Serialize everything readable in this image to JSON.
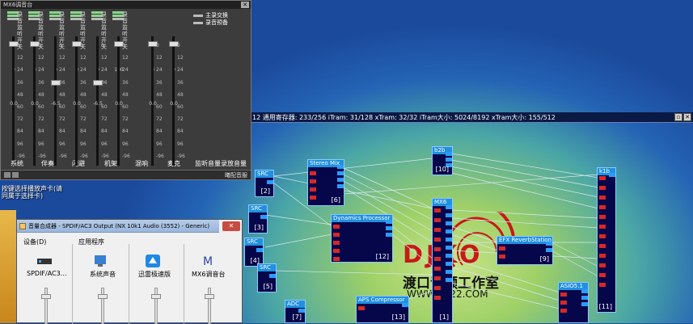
{
  "mixer": {
    "title": "MX6调音台",
    "switch_labels": [
      "主录交换",
      "录音预备"
    ],
    "channels": [
      {
        "name": "系统",
        "toggles": [
          "录",
          "监",
          "开"
        ],
        "toggles2": [
          "音",
          "听",
          "关"
        ],
        "value": "0.0",
        "level": 0.0
      },
      {
        "name": "伴奏",
        "toggles": [
          "录",
          "监",
          "开"
        ],
        "toggles2": [
          "音",
          "听",
          "关"
        ],
        "value": "0.0",
        "level": 0.0
      },
      {
        "name": "闪避",
        "toggles": [
          "录",
          "监",
          "开"
        ],
        "toggles2": [
          "音",
          "听",
          "关"
        ],
        "value": "-6.5",
        "level": 0.08
      },
      {
        "name": "机架",
        "toggles": [
          "录",
          "监",
          "开"
        ],
        "toggles2": [
          "音",
          "听",
          "关"
        ],
        "value": "0.0",
        "level": 0.0
      },
      {
        "name": "混响",
        "toggles": [
          "录",
          "监",
          "开"
        ],
        "toggles2": [
          "音",
          "听",
          "关"
        ],
        "value": "-6.5",
        "level": 0.08
      },
      {
        "name": "麦克",
        "toggles": [
          "录",
          "监",
          "开"
        ],
        "toggles2": [
          "音",
          "听",
          "关"
        ],
        "value": "0.0",
        "level": 0.0
      },
      {
        "name": "监听音量",
        "toggles": [],
        "toggles2": [],
        "value": "0.0",
        "level": 0.0
      },
      {
        "name": "录放音量",
        "toggles": [],
        "toggles2": [],
        "value": "0.0",
        "level": 0.0
      }
    ],
    "top_values": [
      "0",
      "0",
      "0",
      "0",
      "0",
      "100",
      "0",
      "0"
    ],
    "scale": [
      "0",
      "12",
      "24",
      "36",
      "48",
      "60",
      "72",
      "84",
      "96",
      "-96"
    ],
    "brand": "曦配音服"
  },
  "dsp": {
    "status": "12 通用寄存器: 233/256 iTram: 31/128 xTram: 32/32 iTram大小: 5024/8192 xTram大小: 155/512",
    "blocks": {
      "src2": "SRC",
      "src2n": "[2]",
      "stereo": "Stereo Mix",
      "stereon": "[6]",
      "b2b": "b2b",
      "b2bn": "[10]",
      "k1b": "k1b",
      "src3": "SRC",
      "src3n": "[3]",
      "dyn": "Dynamics Processor",
      "dynn": "[12]",
      "mx6": "MX6",
      "mx6n": "[1]",
      "src4": "SRC",
      "src4n": "[4]",
      "src5": "SRC",
      "src5n": "[5]",
      "efx": "EFX ReverbStation",
      "efxn": "[9]",
      "adc": "ADC",
      "adcn": "[7]",
      "aps": "APS Compressor",
      "apsn": "[13]",
      "asio": "ASIO5.1",
      "k1bn": "[11]"
    }
  },
  "watermark": {
    "letters": "DJKO",
    "cn": "渡口音频工作室",
    "url": "WWW.2222.COM"
  },
  "tooltip": {
    "line1": "按键选择播放声卡(请",
    "line2": "同属于选择卡)"
  },
  "volume": {
    "title": "音量合成器 - SPDIF/AC3 Output (NX 10k1 Audio (3552) - Generic)",
    "close": "✕",
    "device_group": "设备(D)",
    "apps_group": "应用程序",
    "device_name": "SPDIF/AC3...",
    "apps": [
      "系统声音",
      "迅雷极速版",
      "MX6调音台"
    ]
  }
}
